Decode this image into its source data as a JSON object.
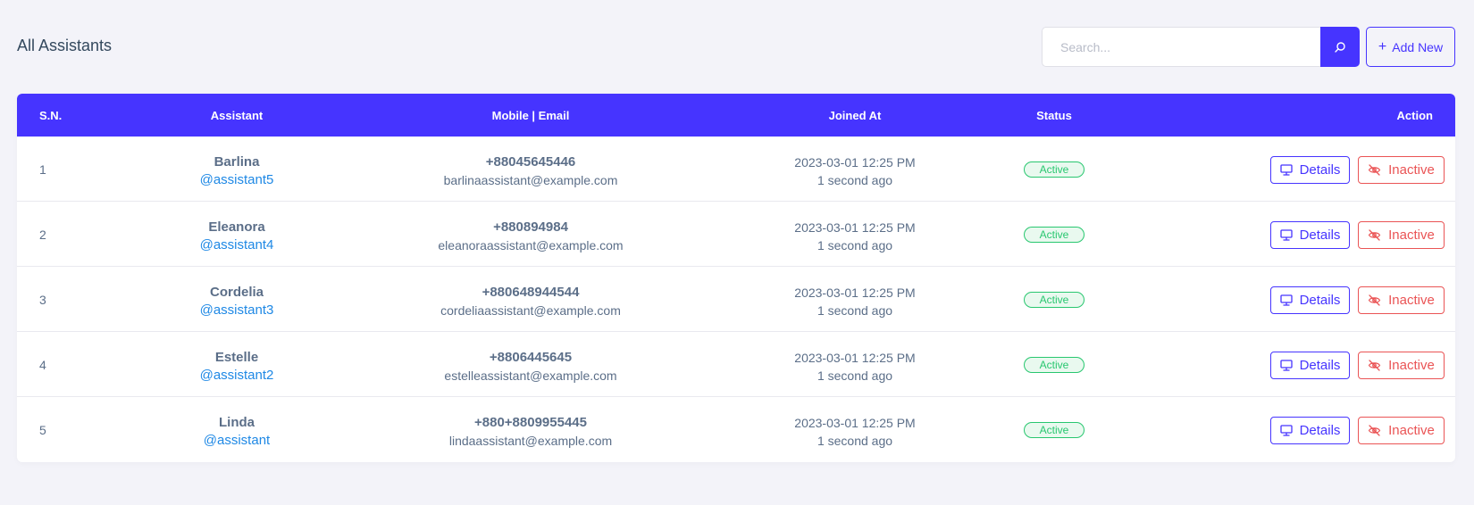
{
  "page": {
    "title": "All Assistants"
  },
  "search": {
    "placeholder": "Search..."
  },
  "toolbar": {
    "add_label": "Add New",
    "add_icon": "plus-icon",
    "search_icon": "search-icon"
  },
  "colors": {
    "primary": "#4634ff",
    "success": "#28c76f",
    "danger": "#ea5455",
    "link": "#1e88e5",
    "background": "#f3f3f9"
  },
  "table": {
    "headers": [
      "S.N.",
      "Assistant",
      "Mobile | Email",
      "Joined At",
      "Status",
      "Action"
    ],
    "rows": [
      {
        "sn": "1",
        "name": "Barlina",
        "username": "@assistant5",
        "mobile": "+88045645446",
        "email": "barlinaassistant@example.com",
        "joined_date": "2023-03-01 12:25 PM",
        "joined_ago": "1 second ago",
        "status": "Active",
        "details_label": "Details",
        "inactive_label": "Inactive"
      },
      {
        "sn": "2",
        "name": "Eleanora",
        "username": "@assistant4",
        "mobile": "+880894984",
        "email": "eleanoraassistant@example.com",
        "joined_date": "2023-03-01 12:25 PM",
        "joined_ago": "1 second ago",
        "status": "Active",
        "details_label": "Details",
        "inactive_label": "Inactive"
      },
      {
        "sn": "3",
        "name": "Cordelia",
        "username": "@assistant3",
        "mobile": "+880648944544",
        "email": "cordeliaassistant@example.com",
        "joined_date": "2023-03-01 12:25 PM",
        "joined_ago": "1 second ago",
        "status": "Active",
        "details_label": "Details",
        "inactive_label": "Inactive"
      },
      {
        "sn": "4",
        "name": "Estelle",
        "username": "@assistant2",
        "mobile": "+8806445645",
        "email": "estelleassistant@example.com",
        "joined_date": "2023-03-01 12:25 PM",
        "joined_ago": "1 second ago",
        "status": "Active",
        "details_label": "Details",
        "inactive_label": "Inactive"
      },
      {
        "sn": "5",
        "name": "Linda",
        "username": "@assistant",
        "mobile": "+880+8809955445",
        "email": "lindaassistant@example.com",
        "joined_date": "2023-03-01 12:25 PM",
        "joined_ago": "1 second ago",
        "status": "Active",
        "details_label": "Details",
        "inactive_label": "Inactive"
      }
    ]
  }
}
